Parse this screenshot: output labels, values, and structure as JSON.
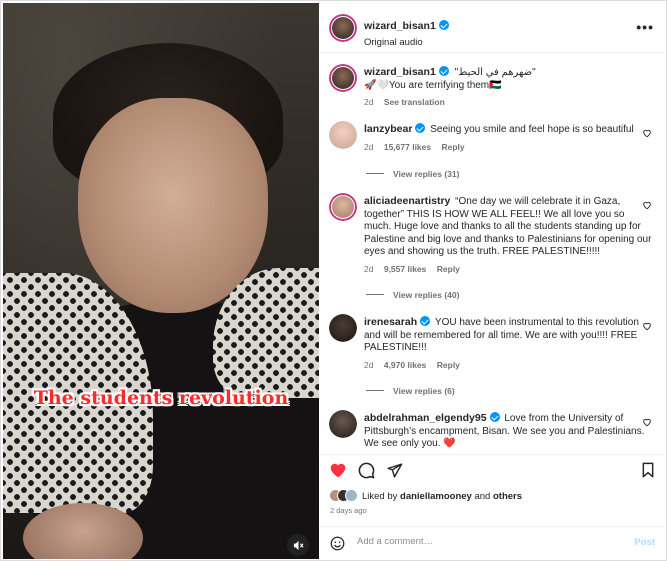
{
  "video": {
    "caption": "The students revolution",
    "mute_icon": "speaker-muted-icon"
  },
  "header": {
    "username": "wizard_bisan1",
    "audio": "Original audio",
    "more_icon": "ellipsis-icon"
  },
  "caption_post": {
    "username": "wizard_bisan1",
    "arabic_quote": "\"ضهرهم في الحيط\"",
    "text": "🚀🤍You are terrifying them🇵🇸",
    "time": "2d",
    "see_translation": "See translation"
  },
  "comments": [
    {
      "username": "lanzybear",
      "verified": true,
      "text": "Seeing you smile and feel hope is so beautiful",
      "time": "2d",
      "likes": "15,677 likes",
      "reply": "Reply",
      "view_replies": "View replies (31)"
    },
    {
      "username": "aliciadeenartistry",
      "verified": false,
      "text": "“One day we will celebrate it in Gaza, together” THIS IS HOW WE ALL FEEL!! We all love you so much. Huge love and thanks to all the students standing up for Palestine and big love and thanks to Palestinians for opening our eyes and showing us the truth. FREE PALESTINE!!!!!",
      "time": "2d",
      "likes": "9,557 likes",
      "reply": "Reply",
      "view_replies": "View replies (40)"
    },
    {
      "username": "irenesarah",
      "verified": true,
      "text": "YOU have been instrumental to this revolution and will be remembered for all time. We are with you!!!! FREE PALESTINE!!!",
      "time": "2d",
      "likes": "4,970 likes",
      "reply": "Reply",
      "view_replies": "View replies (6)"
    },
    {
      "username": "abdelrahman_elgendy95",
      "verified": true,
      "text": "Love from the University of Pittsburgh’s encampment, Bisan. We see you and Palestinians. We see only you. ❤️"
    }
  ],
  "actions": {
    "liked_by_prefix": "Liked by",
    "liked_by_user": "daniellamooney",
    "and": "and",
    "others": "others",
    "date": "2 days ago"
  },
  "comment_input": {
    "placeholder": "Add a comment…",
    "post_label": "Post"
  },
  "colors": {
    "like_red": "#ff3040",
    "verified_blue": "#0095f6",
    "caption_red": "#ff2a2a"
  }
}
